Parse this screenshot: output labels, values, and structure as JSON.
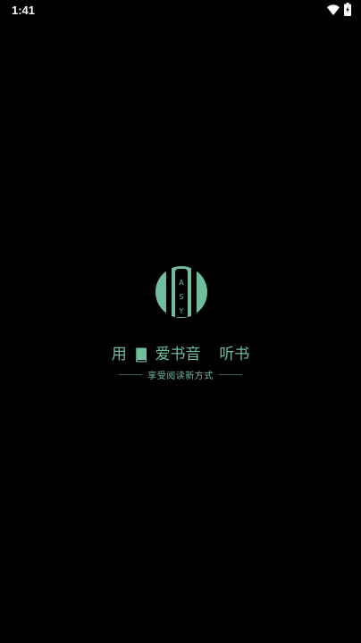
{
  "status_bar": {
    "time": "1:41",
    "icons": [
      "wifi-icon",
      "battery-icon"
    ]
  },
  "splash": {
    "logo": {
      "icon": "asy-logo",
      "letters": [
        "A",
        "S",
        "Y"
      ]
    },
    "title": {
      "part1": "用",
      "book_icon": "book-icon",
      "part2": "爱书音",
      "part3": "听书"
    },
    "tagline": "享受阅读新方式"
  },
  "colors": {
    "background": "#000000",
    "accent": "#6fbe9d",
    "divider": "#3f5f52",
    "status_text": "#ffffff"
  }
}
